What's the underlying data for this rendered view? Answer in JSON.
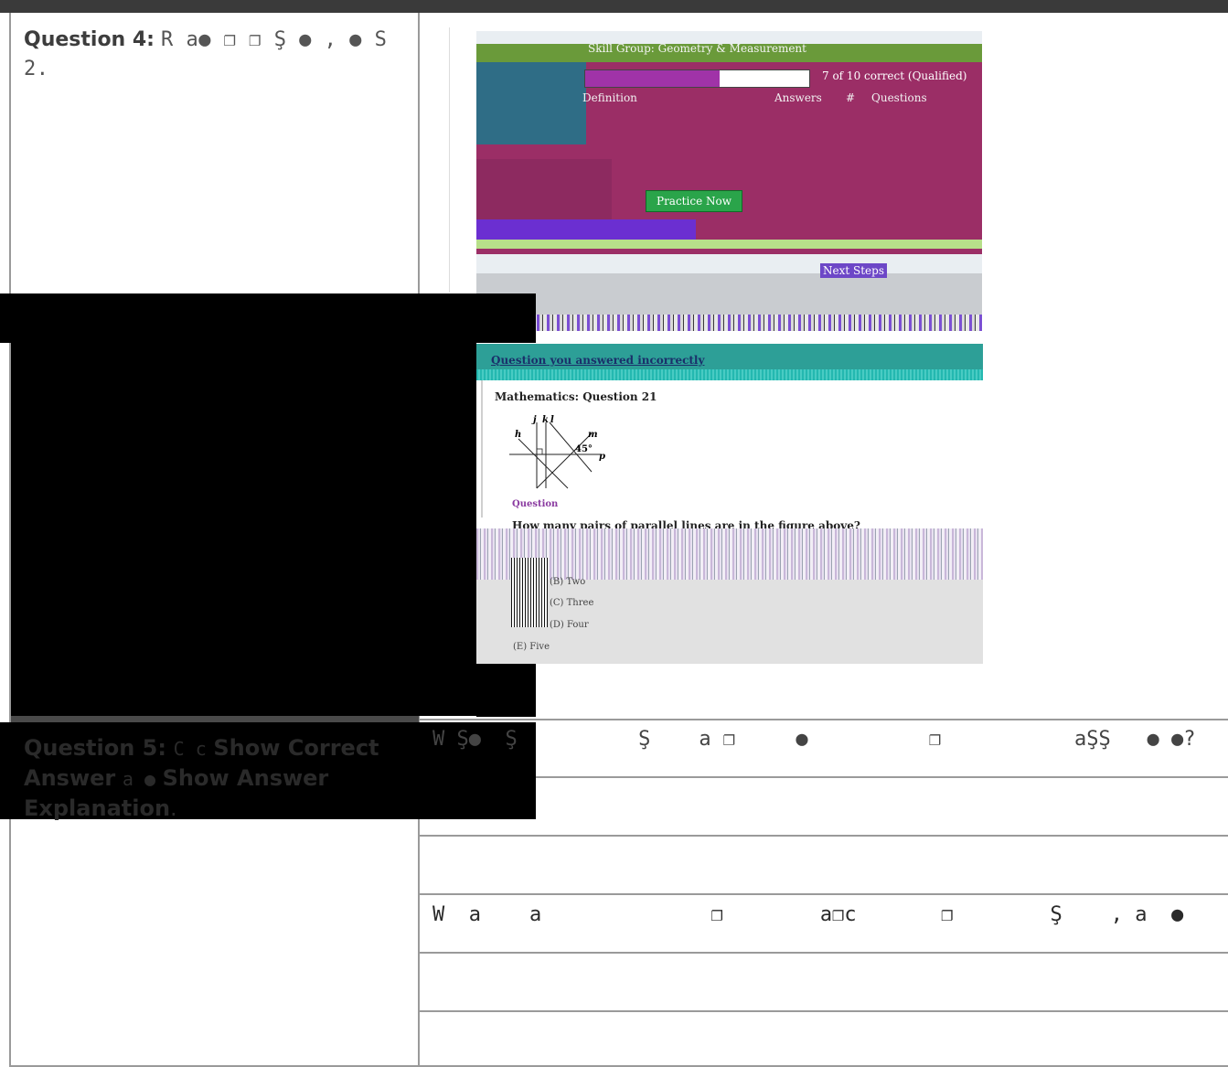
{
  "question4": {
    "title": "Question 4:",
    "text": "R a●      ❐     ❐  Ş   ●   ,  ●   S   2."
  },
  "screenshot_top": {
    "title": "Skill Group: Geometry & Measurement",
    "progress_text": "7 of 10 correct (Qualified)",
    "progress_fraction": 0.6,
    "col_definition": "Definition",
    "col_answers": "Answers",
    "col_hash": "#",
    "col_questions": "Questions",
    "practice_button": "Practice Now",
    "next_steps": "Next Steps"
  },
  "screenshot_bottom": {
    "header": "Question you answered incorrectly",
    "subject": "Mathematics: Question 21",
    "figure_labels": [
      "j",
      "k",
      "l",
      "h",
      "m",
      "45°",
      "p"
    ],
    "question_label": "Question",
    "prompt": "How many pairs of parallel lines are in the figure above?",
    "options": [
      "(B) Two",
      "(C) Three",
      "(D) Four",
      "(E) Five"
    ]
  },
  "question5": {
    "title": "Question 5:",
    "text_a": "C  c",
    "bold_a": "Show Correct Answer",
    "text_b": "a  ●",
    "bold_b": "Show Answer Explanation",
    "tail": "."
  },
  "table_rows": {
    "row1": "W Ş●  Ş          Ş    a ❐     ●          ❐           aŞŞ   ● ●?",
    "row2": "",
    "row3": "",
    "row4": "W  a    a              ❐        a❐c       ❐        Ş    , a  ●      Ş?",
    "row5": "",
    "row6": ""
  }
}
